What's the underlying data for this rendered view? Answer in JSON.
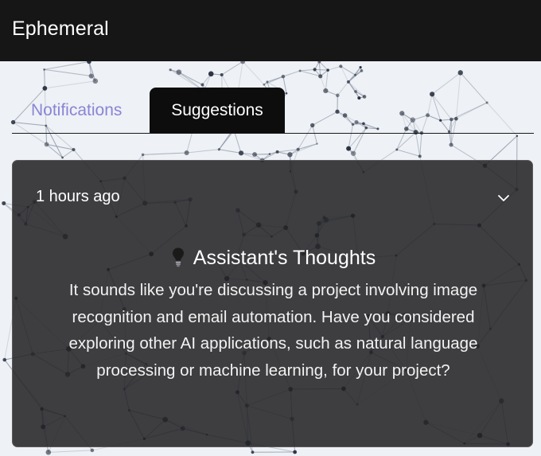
{
  "header": {
    "title": "Ephemeral"
  },
  "tabs": [
    {
      "label": "Notifications",
      "active": false
    },
    {
      "label": "Suggestions",
      "active": true
    }
  ],
  "suggestion": {
    "time": "1 hours ago",
    "icon": "lightbulb-icon",
    "title": "Assistant's Thoughts",
    "body": "It sounds like you're discussing a project involving image recognition and email automation. Have you considered exploring other AI applications, such as natural language processing or machine learning, for your project?",
    "expand_icon": "chevron-down-icon"
  },
  "colors": {
    "header_bg": "#161616",
    "inactive_tab": "#8a84d6",
    "active_tab_bg": "#0d0d0d",
    "card_bg": "#212123"
  }
}
